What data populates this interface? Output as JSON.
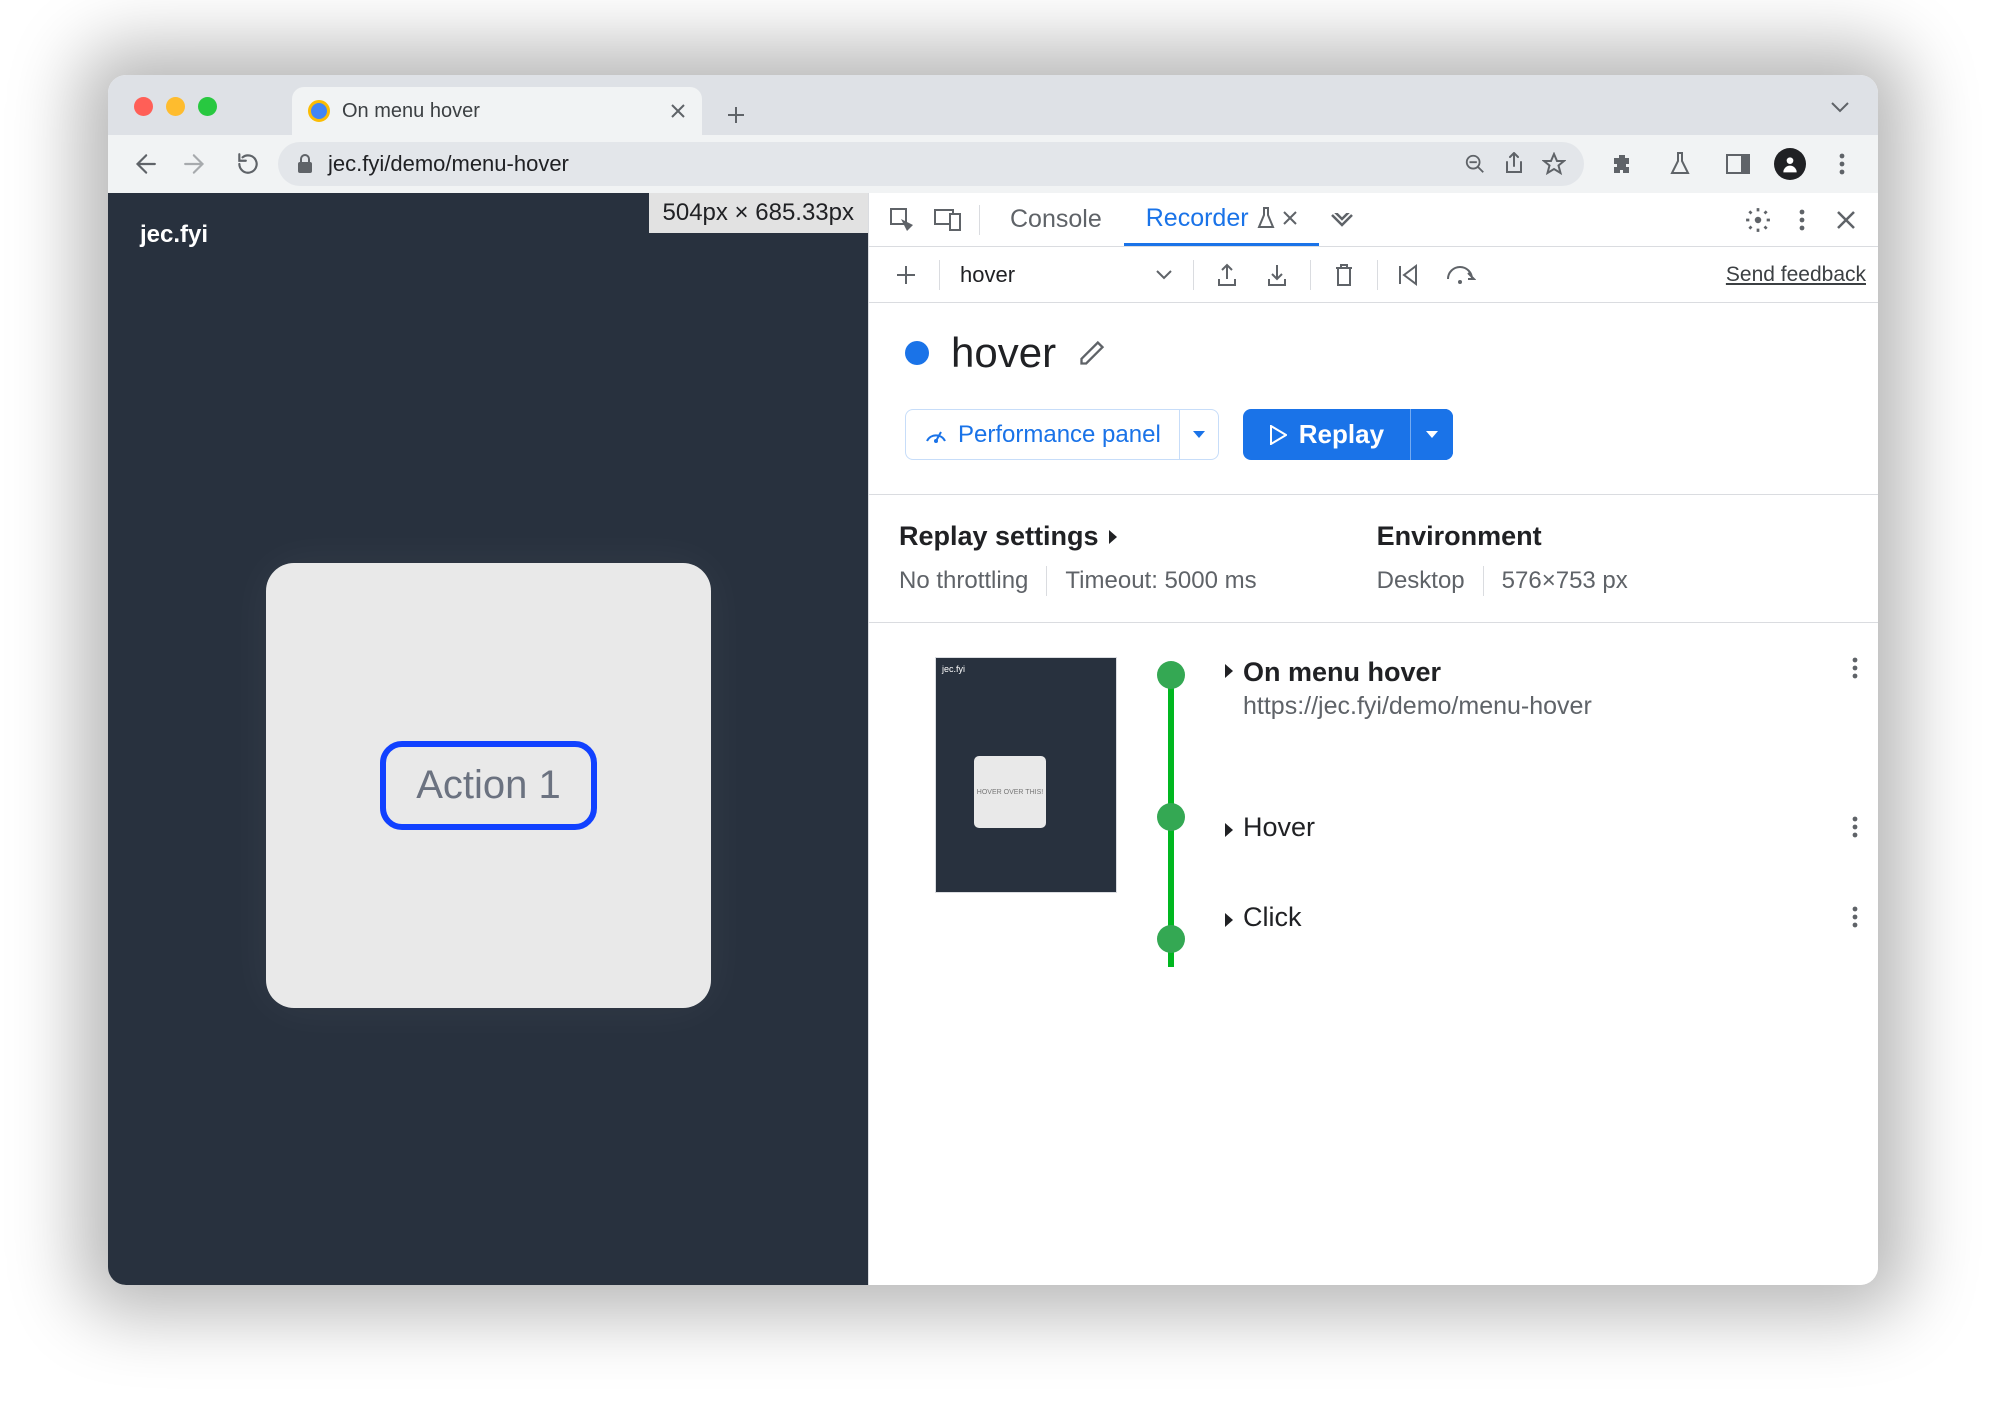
{
  "browser": {
    "tab_title": "On menu hover",
    "url_display": "jec.fyi/demo/menu-hover"
  },
  "page": {
    "site_label": "jec.fyi",
    "size_overlay": "504px × 685.33px",
    "action_button": "Action 1"
  },
  "devtools": {
    "tabs": {
      "console": "Console",
      "recorder": "Recorder"
    },
    "toolbar": {
      "recording_name": "hover",
      "feedback": "Send feedback"
    },
    "title": "hover",
    "buttons": {
      "performance": "Performance panel",
      "replay": "Replay"
    },
    "settings": {
      "replay_heading": "Replay settings",
      "throttling": "No throttling",
      "timeout": "Timeout: 5000 ms",
      "env_heading": "Environment",
      "device": "Desktop",
      "viewport": "576×753 px"
    }
  },
  "steps": [
    {
      "name": "On menu hover",
      "url": "https://jec.fyi/demo/menu-hover"
    },
    {
      "name": "Hover"
    },
    {
      "name": "Click"
    }
  ]
}
